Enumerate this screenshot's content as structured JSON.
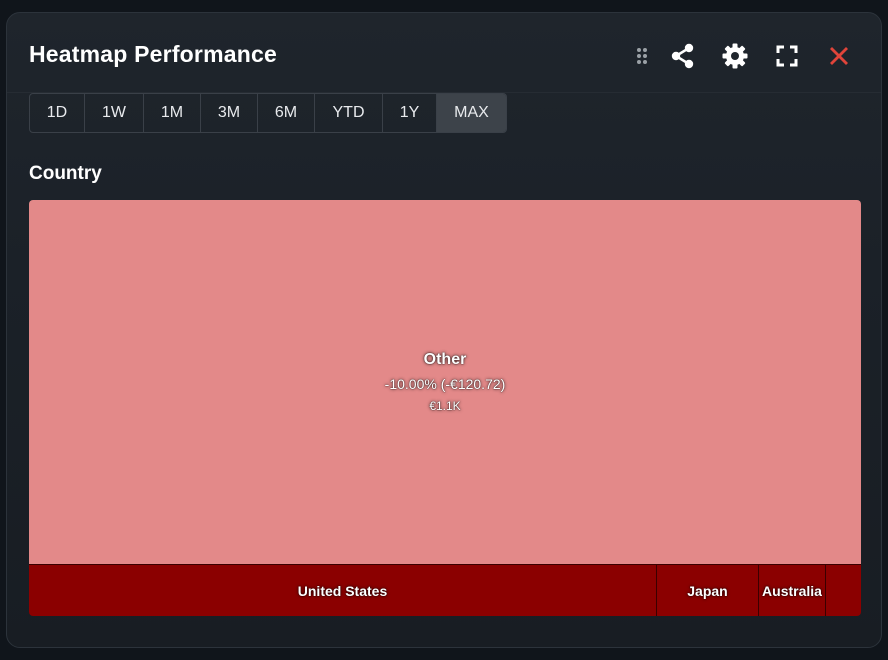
{
  "widget": {
    "title": "Heatmap Performance",
    "icons": [
      "drag-handle-icon",
      "share-icon",
      "gear-icon",
      "fullscreen-icon",
      "close-icon"
    ],
    "close_color": "#e0443a"
  },
  "timeframes": {
    "options": [
      "1D",
      "1W",
      "1M",
      "3M",
      "6M",
      "YTD",
      "1Y",
      "MAX"
    ],
    "selected": "MAX"
  },
  "section_label": "Country",
  "treemap": {
    "tiles": [
      {
        "name": "Other",
        "change": "-10.00% (-€120.72)",
        "value": "€1.1K",
        "color": "#e38989"
      },
      {
        "name": "United States",
        "color": "#8b0000"
      },
      {
        "name": "Japan",
        "color": "#8b0000"
      },
      {
        "name": "Australia",
        "color": "#8b0000"
      },
      {
        "name": "",
        "color": "#8b0000"
      }
    ]
  }
}
